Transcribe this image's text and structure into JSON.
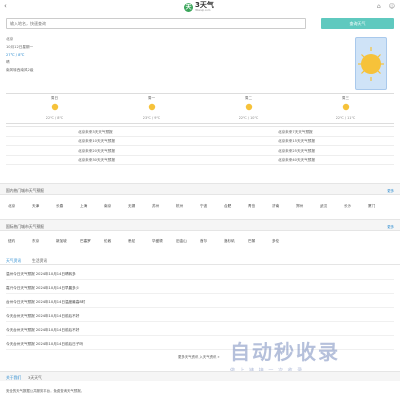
{
  "header": {
    "back_icon": "chevron-left-icon",
    "logo_mark": "天",
    "logo_text": "3天气",
    "logo_sub": "3tianqi.com",
    "home_icon": "home-icon",
    "user_icon": "user-icon"
  },
  "search": {
    "placeholder": "输入地名，快速查询",
    "button_label": "查询天气"
  },
  "current": {
    "city": "北京",
    "updated": "10月12日星期一",
    "temp": "27℃ / 8℃",
    "condition": "晴",
    "wind": "南风转西南风2级",
    "icon": "sun-icon"
  },
  "forecast": [
    {
      "day": "周日",
      "temp": "22℃ / 8℃",
      "icon": "sun-icon"
    },
    {
      "day": "周一",
      "temp": "23℃ / 9℃",
      "icon": "sun-icon"
    },
    {
      "day": "周二",
      "temp": "22℃ / 10℃",
      "icon": "sun-icon"
    },
    {
      "day": "周三",
      "temp": "22℃ / 11℃",
      "icon": "sun-icon"
    }
  ],
  "forecast_links": [
    [
      "北京未来3天天气预报",
      "北京未来7天天气预报"
    ],
    [
      "北京未来10天天气预报",
      "北京未来15天天气预报"
    ],
    [
      "北京未来20天天气预报",
      "北京未来25天天气预报"
    ],
    [
      "北京未来30天天气预报",
      "北京未来40天天气预报"
    ]
  ],
  "domestic": {
    "title": "国内热门城市天气预报",
    "more": "更多",
    "cities": [
      "北京",
      "天津",
      "长春",
      "上海",
      "南京",
      "无锡",
      "苏州",
      "杭州",
      "宁波",
      "合肥",
      "青岛",
      "济南",
      "郑州",
      "武汉",
      "长沙",
      "厦门"
    ]
  },
  "international": {
    "title": "国际热门城市天气预报",
    "more": "更多",
    "cities": [
      "纽约",
      "东京",
      "新加坡",
      "巴塞罗",
      "伦敦",
      "悉尼",
      "华盛顿",
      "旧金山",
      "首尔",
      "洛杉矶",
      "巴黎",
      "多伦"
    ]
  },
  "news_tabs": [
    "天气资讯",
    "生活资讯"
  ],
  "news": [
    "温州今日天气预报 2024年10月14日晴转多",
    "嘉兴今日天气预报 2024年10月14日早晨多少",
    "台州今日天气预报 2024年10月14日温度最高8时",
    "今天台州天气预报 2024年10月14日前后不好",
    "今天台州天气预报 2024年10月14日前后不好",
    "今天台州天气预报 2024年10月14日前后日子吗"
  ],
  "more_news": "更多天气资讯 入天气资讯 »",
  "watermark": {
    "main": "自动秒收录",
    "sub": "做 上 链 接 一 次 收 录"
  },
  "footer": {
    "tab_a": "关于我们",
    "tab_b": "3天天气",
    "text": "安全的天气数据公共服务平台，免费查询天气预报。"
  },
  "colors": {
    "accent": "#5fc9bf",
    "link": "#2a8bd0",
    "sun": "#f6c23a"
  }
}
